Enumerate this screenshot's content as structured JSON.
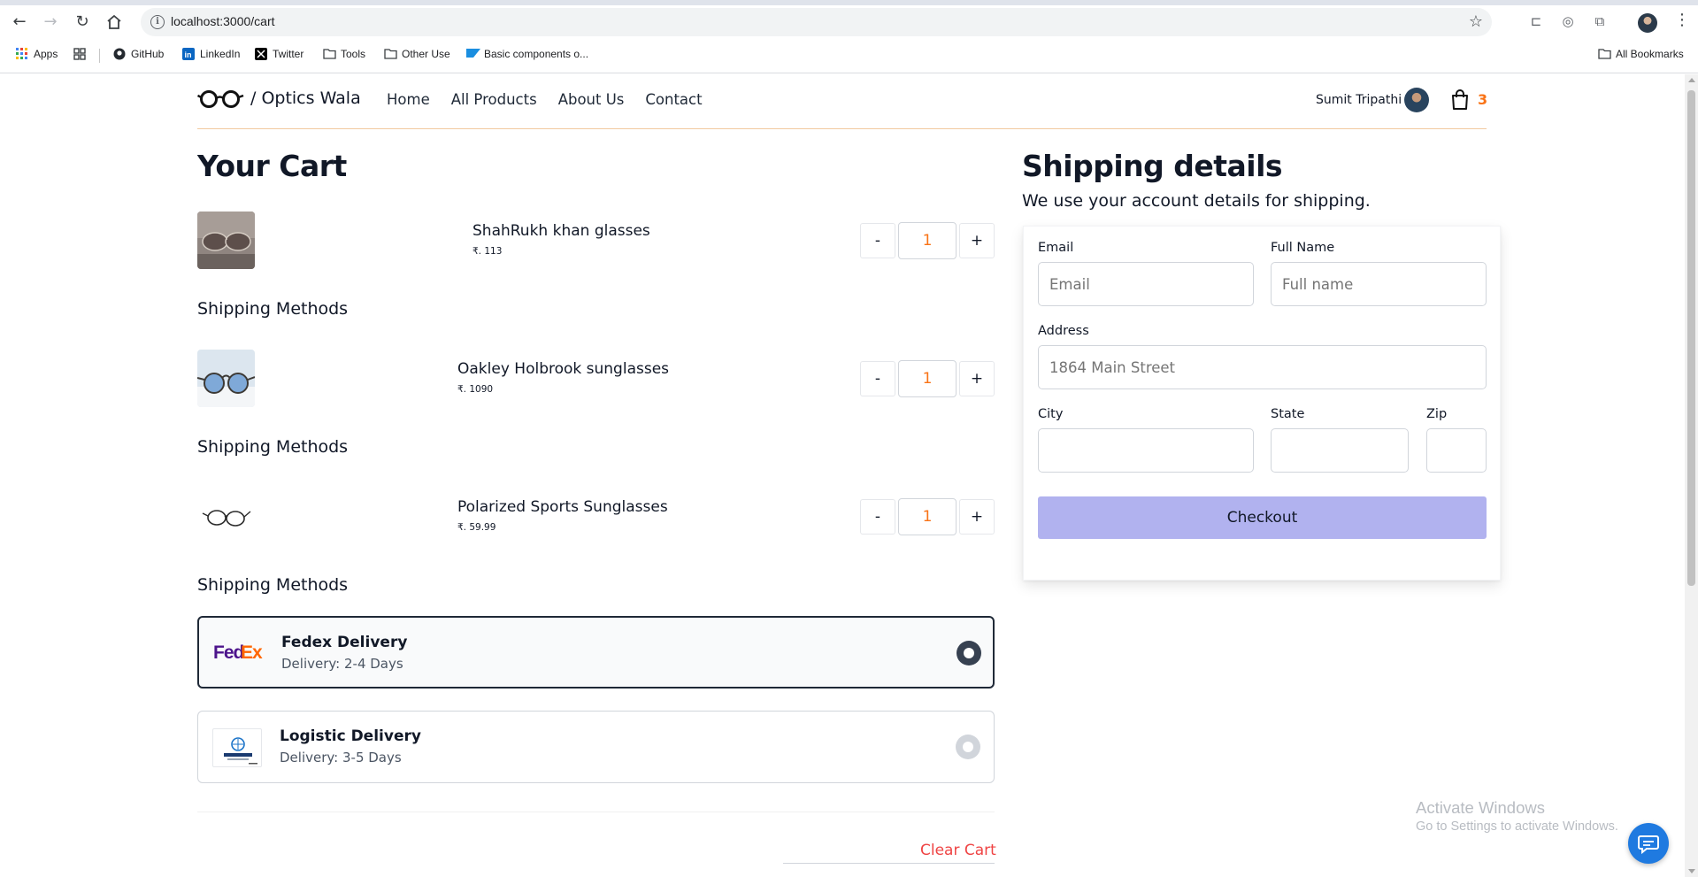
{
  "browser": {
    "url": "localhost:3000/cart",
    "bookmarks": [
      {
        "label": "Apps",
        "icon": "apps-grid-icon"
      },
      {
        "label": "",
        "icon": "tab-groups-icon"
      },
      {
        "label": "GitHub",
        "icon": "github-icon"
      },
      {
        "label": "LinkedIn",
        "icon": "linkedin-icon"
      },
      {
        "label": "Twitter",
        "icon": "x-twitter-icon"
      },
      {
        "label": "Tools",
        "icon": "folder-icon"
      },
      {
        "label": "Other Use",
        "icon": "folder-icon"
      },
      {
        "label": "Basic components o...",
        "icon": "sap-icon"
      }
    ],
    "all_bookmarks": "All Bookmarks"
  },
  "header": {
    "brand": "/ Optics Wala",
    "nav": [
      "Home",
      "All Products",
      "About Us",
      "Contact"
    ],
    "user_name": "Sumit Tripathi",
    "cart_count": "3"
  },
  "cart": {
    "title": "Your Cart",
    "items": [
      {
        "name": "ShahRukh khan glasses",
        "price": "₹. 113",
        "qty": "1",
        "minus": "-",
        "plus": "+"
      },
      {
        "name": "Oakley Holbrook sunglasses",
        "price": "₹. 1090",
        "qty": "1",
        "minus": "-",
        "plus": "+"
      },
      {
        "name": "Polarized Sports Sunglasses",
        "price": "₹. 59.99",
        "qty": "1",
        "minus": "-",
        "plus": "+"
      }
    ],
    "shipping_methods_label": "Shipping Methods",
    "shipping_options": [
      {
        "title": "Fedex Delivery",
        "delivery": "Delivery: 2-4 Days",
        "selected": true
      },
      {
        "title": "Logistic Delivery",
        "delivery": "Delivery: 3-5 Days",
        "selected": false
      }
    ],
    "clear_cart": "Clear Cart"
  },
  "shipping": {
    "title": "Shipping details",
    "subtitle": "We use your account details for shipping.",
    "fields": {
      "email": {
        "label": "Email",
        "placeholder": "Email"
      },
      "full_name": {
        "label": "Full Name",
        "placeholder": "Full name"
      },
      "address": {
        "label": "Address",
        "placeholder": "1864 Main Street"
      },
      "city": {
        "label": "City",
        "placeholder": ""
      },
      "state": {
        "label": "State",
        "placeholder": ""
      },
      "zip": {
        "label": "Zip",
        "placeholder": ""
      }
    },
    "checkout": "Checkout"
  },
  "windows": {
    "activate_title": "Activate Windows",
    "activate_sub": "Go to Settings to activate Windows."
  },
  "colors": {
    "accent_orange": "#f97316",
    "checkout_bg": "#b1b2ef",
    "clear_cart": "#ef4444"
  }
}
